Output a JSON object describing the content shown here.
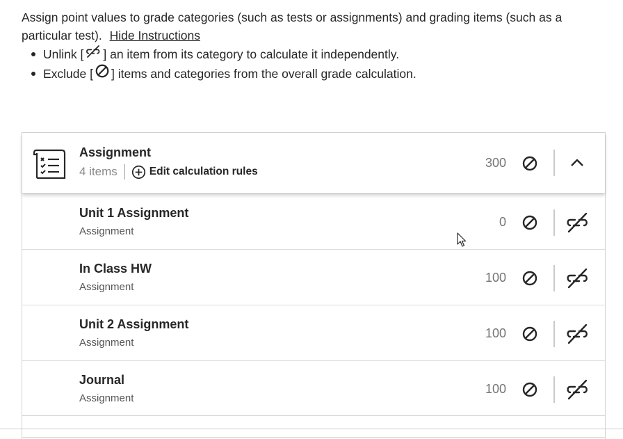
{
  "instructions": {
    "text": "Assign point values to grade categories (such as tests or assignments) and grading items (such as a particular test).",
    "hide_link": "Hide Instructions",
    "bullets": [
      {
        "prefix": "Unlink [",
        "suffix": "] an item from its category to calculate it independently.",
        "icon": "unlink-icon"
      },
      {
        "prefix": "Exclude [",
        "suffix": "] items and categories from the overall grade calculation.",
        "icon": "exclude-icon"
      }
    ]
  },
  "category": {
    "title": "Assignment",
    "count": "4 items",
    "edit_rules": "Edit calculation rules",
    "points": "300",
    "icon": "checklist-icon"
  },
  "items": [
    {
      "title": "Unit 1 Assignment",
      "type": "Assignment",
      "points": "0"
    },
    {
      "title": "In Class HW",
      "type": "Assignment",
      "points": "100"
    },
    {
      "title": "Unit 2 Assignment",
      "type": "Assignment",
      "points": "100"
    },
    {
      "title": "Journal",
      "type": "Assignment",
      "points": "100"
    }
  ]
}
